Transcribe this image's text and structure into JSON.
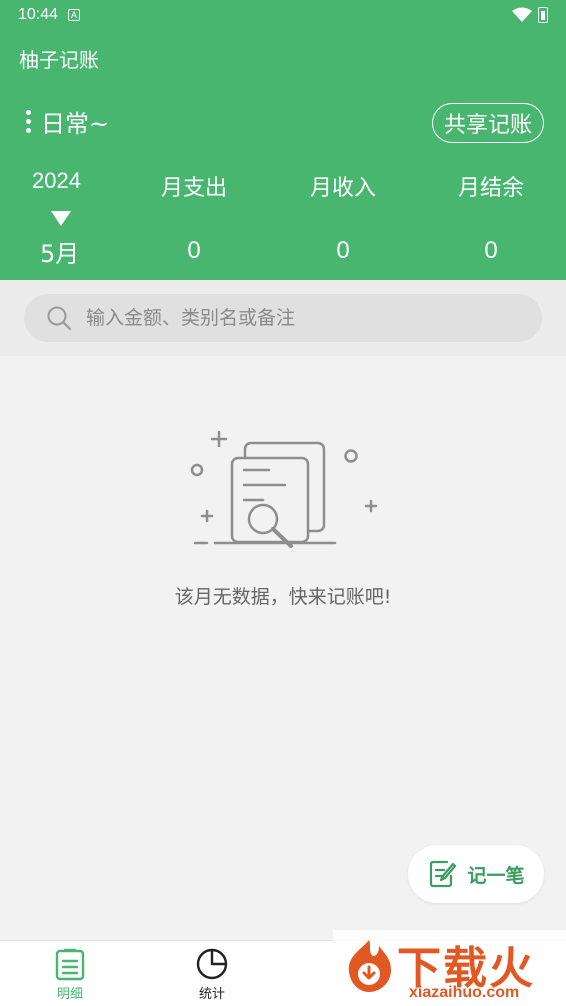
{
  "status_bar": {
    "time": "10:44",
    "notif_icon_letter": "A"
  },
  "header": {
    "app_title": "柚子记账",
    "book_name": "日常~",
    "share_label": "共享记账",
    "year": "2024",
    "month": "5月",
    "stats": [
      {
        "label": "月支出",
        "value": "0"
      },
      {
        "label": "月收入",
        "value": "0"
      },
      {
        "label": "月结余",
        "value": "0"
      }
    ]
  },
  "search": {
    "placeholder": "输入金额、类别名或备注",
    "value": ""
  },
  "empty_state": {
    "text": "该月无数据，快来记账吧!"
  },
  "fab": {
    "label": "记一笔"
  },
  "tabs": [
    {
      "label": "明细",
      "active": true
    },
    {
      "label": "统计",
      "active": false
    }
  ],
  "watermark": {
    "text": "下载火",
    "url": "xiazaihuo.com"
  },
  "colors": {
    "primary": "#48b66f",
    "accent_text": "#3a9c5e",
    "background": "#f2f2f2",
    "watermark": "#e25822"
  }
}
